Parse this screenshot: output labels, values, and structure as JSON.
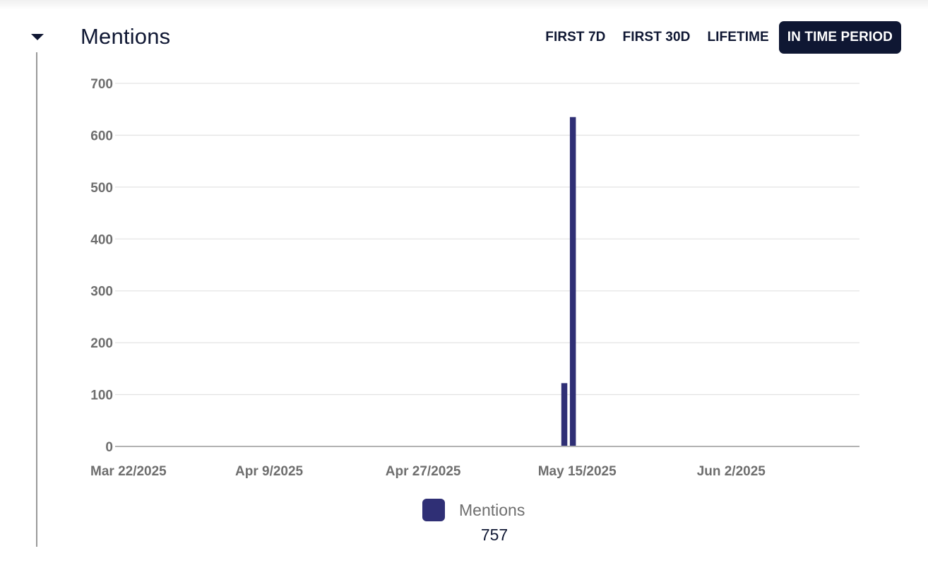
{
  "panel": {
    "title": "Mentions"
  },
  "range_tabs": [
    {
      "label": "FIRST 7D",
      "active": false
    },
    {
      "label": "FIRST 30D",
      "active": false
    },
    {
      "label": "LIFETIME",
      "active": false
    },
    {
      "label": "IN TIME PERIOD",
      "active": true
    }
  ],
  "icons": {
    "collapse": "caret-down-icon"
  },
  "colors": {
    "bar": "#2f2f75",
    "accent": "#0f1733",
    "grid": "#e4e4e4",
    "axis": "#b3b3b3"
  },
  "legend": {
    "label": "Mentions",
    "total": "757"
  },
  "chart_data": {
    "type": "bar",
    "title": "Mentions",
    "xlabel": "",
    "ylabel": "",
    "ylim": [
      0,
      700
    ],
    "yticks": [
      0,
      100,
      200,
      300,
      400,
      500,
      600,
      700
    ],
    "xlim": [
      "2025-03-22",
      "2025-06-17"
    ],
    "xticks": [
      {
        "date": "2025-03-22",
        "label": "Mar 22/2025"
      },
      {
        "date": "2025-04-09",
        "label": "Apr 9/2025"
      },
      {
        "date": "2025-04-27",
        "label": "Apr 27/2025"
      },
      {
        "date": "2025-05-15",
        "label": "May 15/2025"
      },
      {
        "date": "2025-06-02",
        "label": "Jun 2/2025"
      }
    ],
    "grid": true,
    "legend_position": "bottom",
    "series": [
      {
        "name": "Mentions",
        "points": [
          {
            "x": "2025-05-13",
            "y": 122
          },
          {
            "x": "2025-05-14",
            "y": 635
          }
        ]
      }
    ]
  }
}
